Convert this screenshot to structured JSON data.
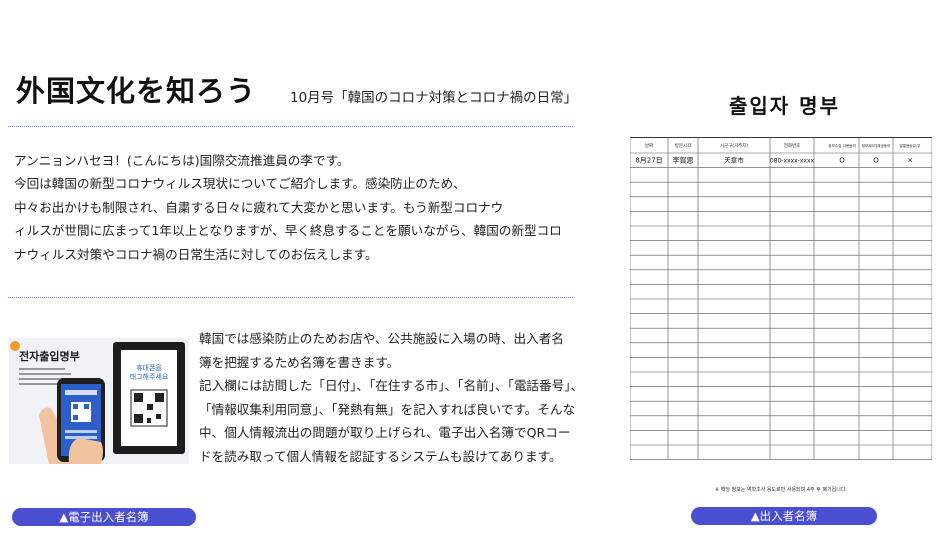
{
  "header": {
    "title": "外国文化を知ろう",
    "subtitle": "10月号「韓国のコロナ対策とコロナ禍の日常」"
  },
  "intro": {
    "lines": [
      "アンニョンハセヨ！(こんにちは)国際交流推進員の李です。",
      "今回は韓国の新型コロナウィルス現状についてご紹介します。感染防止のため、",
      "中々お出かけも制限され、自粛する日々に疲れて大変かと思います。もう新型コロナウ",
      "ィルスが世間に広まって1年以上となりますが、早く終息することを願いながら、韓国の新型コロ",
      "ナウィルス対策やコロナ禍の日常生活に対してのお伝えします。"
    ]
  },
  "thumbnail": {
    "heading": "전자출입명부",
    "phone_header": "전자출입명부",
    "board_text": "휴대폰을\n태그해주세요"
  },
  "para2": {
    "lines": [
      "韓国では感染防止のためお店や、公共施設に入場の時、出入者名",
      "簿を把握するため名簿を書きます。",
      "記入欄には訪問した「日付」、「在住する市」、「名前」、「電話番号」、",
      "「情報収集利用同意」、「発熱有無」を記入すれば良いです。そんな",
      "中、個人情報流出の問題が取り上げられ、電子出入名簿でQRコー",
      "ドを読み取って個人情報を認証するシステムも設けてあります。"
    ]
  },
  "buttons": {
    "electronic": "▲電子出入者名簿",
    "paper": "▲出入者名簿"
  },
  "register": {
    "title": "출입자 명부",
    "headers": [
      "날짜",
      "방문시각",
      "시군구(거주지)",
      "전화번호",
      "정보수집·이용동의",
      "정보제3자제공동의",
      "발열현상유/무"
    ],
    "row": [
      "8月27日",
      "李賀恩",
      "天章市",
      "080-xxxx-xxxx",
      "O",
      "O",
      "×"
    ],
    "note": "※ 해당 정보는 역학조사 용도로만 사용되며 4주 후 폐기됩니다."
  },
  "colors": {
    "button": "#4a4fd1",
    "dotted_rule": "#6d88c9"
  }
}
